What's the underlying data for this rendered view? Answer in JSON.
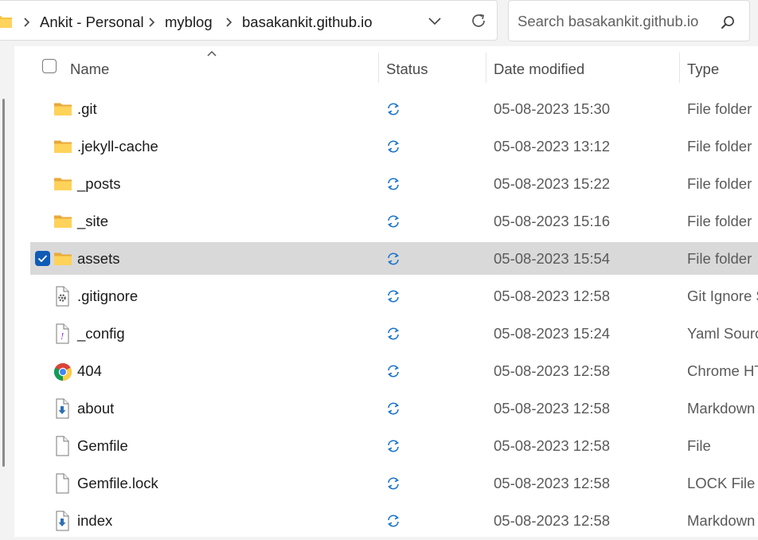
{
  "address_bar": {
    "breadcrumbs": [
      "Ankit - Personal",
      "myblog",
      "basakankit.github.io"
    ]
  },
  "search": {
    "placeholder": "Search basakankit.github.io"
  },
  "columns": {
    "name": "Name",
    "status": "Status",
    "date_modified": "Date modified",
    "type": "Type"
  },
  "files": [
    {
      "name": ".git",
      "icon": "folder-icon",
      "date": "05-08-2023 15:30",
      "type": "File folder",
      "selected": false
    },
    {
      "name": ".jekyll-cache",
      "icon": "folder-icon",
      "date": "05-08-2023 13:12",
      "type": "File folder",
      "selected": false
    },
    {
      "name": "_posts",
      "icon": "folder-icon",
      "date": "05-08-2023 15:22",
      "type": "File folder",
      "selected": false
    },
    {
      "name": "_site",
      "icon": "folder-icon",
      "date": "05-08-2023 15:16",
      "type": "File folder",
      "selected": false
    },
    {
      "name": "assets",
      "icon": "folder-icon",
      "date": "05-08-2023 15:54",
      "type": "File folder",
      "selected": true
    },
    {
      "name": ".gitignore",
      "icon": "settings-file-icon",
      "date": "05-08-2023 12:58",
      "type": "Git Ignore S",
      "selected": false
    },
    {
      "name": "_config",
      "icon": "yaml-file-icon",
      "date": "05-08-2023 15:24",
      "type": "Yaml Sourc",
      "selected": false
    },
    {
      "name": "404",
      "icon": "chrome-icon",
      "date": "05-08-2023 12:58",
      "type": "Chrome HT",
      "selected": false
    },
    {
      "name": "about",
      "icon": "markdown-file-icon",
      "date": "05-08-2023 12:58",
      "type": "Markdown",
      "selected": false
    },
    {
      "name": "Gemfile",
      "icon": "file-icon",
      "date": "05-08-2023 12:58",
      "type": "File",
      "selected": false
    },
    {
      "name": "Gemfile.lock",
      "icon": "file-icon",
      "date": "05-08-2023 12:58",
      "type": "LOCK File",
      "selected": false
    },
    {
      "name": "index",
      "icon": "markdown-file-icon",
      "date": "05-08-2023 12:58",
      "type": "Markdown",
      "selected": false
    }
  ],
  "status_icon": "sync-icon",
  "colors": {
    "selection": "#d9d9d9",
    "accent": "#0f5bb5",
    "sync": "#1a73c9",
    "folder": "#f6c343"
  }
}
